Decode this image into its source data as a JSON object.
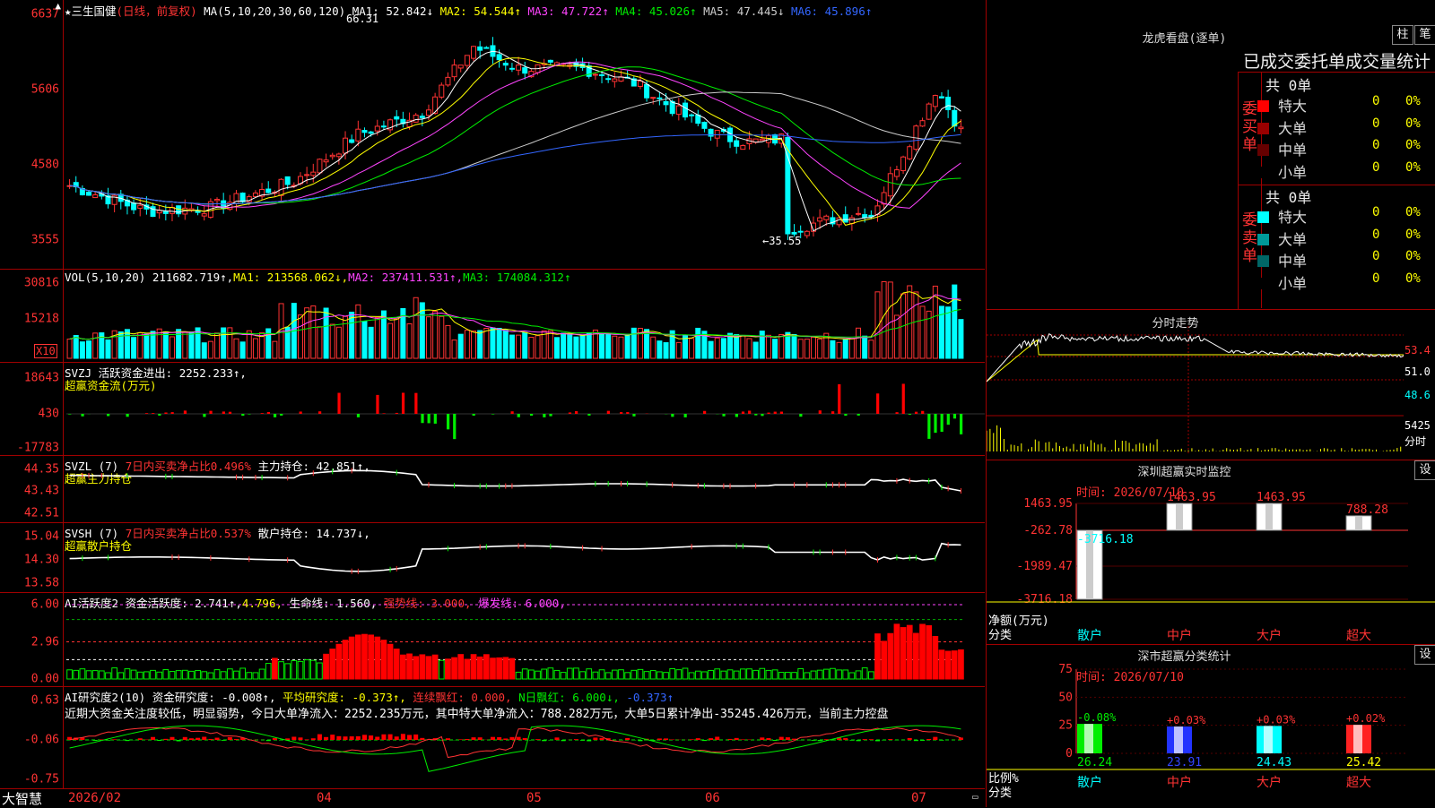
{
  "main": {
    "stock": "三生国健",
    "mode": "(日线，前复权)",
    "ma_params": "MA(5,10,20,30,60,120)",
    "ma": [
      {
        "label": "MA1:",
        "value": "52.842",
        "arrow": "↓",
        "color": "#ffffff"
      },
      {
        "label": "MA2:",
        "value": "54.544",
        "arrow": "↑",
        "color": "#ffff00"
      },
      {
        "label": "MA3:",
        "value": "47.722",
        "arrow": "↑",
        "color": "#ff44ff"
      },
      {
        "label": "MA4:",
        "value": "45.026",
        "arrow": "↑",
        "color": "#00ee00"
      },
      {
        "label": "MA5:",
        "value": "47.445",
        "arrow": "↓",
        "color": "#cccccc"
      },
      {
        "label": "MA6:",
        "value": "45.896",
        "arrow": "↑",
        "color": "#3366ff"
      }
    ],
    "yticks": [
      "6637",
      "5606",
      "4580",
      "3555"
    ],
    "high_label": "66.31",
    "low_label": "←35.55"
  },
  "vol": {
    "params": "VOL(5,10,20)",
    "value": "211682.719↑,",
    "ma": [
      {
        "label": "MA1:",
        "value": "213568.062↓,",
        "color": "#ffff00"
      },
      {
        "label": "MA2:",
        "value": "237411.531↑,",
        "color": "#ff44ff"
      },
      {
        "label": "MA3:",
        "value": "174084.312↑",
        "color": "#00ee00"
      }
    ],
    "yticks": [
      "30816",
      "15218"
    ],
    "x10": "X10"
  },
  "svzj": {
    "name": "SVZJ",
    "desc": "活跃资金进出:",
    "value": "2252.233↑,",
    "sub": "超赢资金流(万元)",
    "yticks": [
      "18643",
      "430",
      "-17783"
    ]
  },
  "svzl": {
    "name": "SVZL (7)",
    "desc": "7日内买卖净占比0.496%",
    "desc2": "主力持仓:",
    "value": "42.851↑,",
    "sub": "超赢主力持仓",
    "yticks": [
      "44.35",
      "43.43",
      "42.51"
    ]
  },
  "svsh": {
    "name": "SVSH (7)",
    "desc": "7日内买卖净占比0.537%",
    "desc2": "散户持仓:",
    "value": "14.737↓,",
    "sub": "超赢散户持仓",
    "yticks": [
      "15.04",
      "14.30",
      "13.58"
    ]
  },
  "ai2": {
    "name": "AI活跃度2",
    "l1": "资金活跃度:",
    "v1": "2.741↑,",
    "v2": "4.796,",
    "l3": "生命线:",
    "v3": "1.560,",
    "l4": "强势线:",
    "v4": "3.000,",
    "l5": "爆发线:",
    "v5": "6.000,",
    "yticks": [
      "6.00",
      "2.96",
      "0.00"
    ]
  },
  "ai_research": {
    "name": "AI研究度2(10)",
    "l1": "资金研究度:",
    "v1": "-0.008↑,",
    "l2": "平均研究度:",
    "v2": "-0.373↑,",
    "l3": "连续飘红:",
    "v3": "0.000,",
    "l4": "N日飘红:",
    "v4": "6.000↓,",
    "v5": "-0.373↑",
    "comment": "近期大资金关注度较低，明显弱势，今日大单净流入：2252.235万元，其中特大单净流入：788.282万元，大单5日累计净出-35245.426万元，当前主力控盘",
    "yticks": [
      "0.63",
      "-0.06",
      "-0.75"
    ]
  },
  "xaxis": {
    "labels": [
      "2026/02",
      "04",
      "05",
      "06",
      "07"
    ],
    "brand": "大智慧"
  },
  "lhb": {
    "title": "龙虎看盘(逐单)",
    "btn1": "柱",
    "btn2": "笔",
    "header": "已成交委托单成交量统计",
    "buy_side": "委买单",
    "sell_side": "委卖单",
    "buy_total": "共 0单",
    "sell_total": "共 0单",
    "buy_rows": [
      {
        "label": "特大",
        "n": "0",
        "p": "0%",
        "color": "#ff0000"
      },
      {
        "label": "大单",
        "n": "0",
        "p": "0%",
        "color": "#990000"
      },
      {
        "label": "中单",
        "n": "0",
        "p": "0%",
        "color": "#660000"
      },
      {
        "label": "小单",
        "n": "0",
        "p": "0%",
        "color": "#000000"
      }
    ],
    "sell_rows": [
      {
        "label": "特大",
        "n": "0",
        "p": "0%",
        "color": "#00ffff"
      },
      {
        "label": "大单",
        "n": "0",
        "p": "0%",
        "color": "#009999"
      },
      {
        "label": "中单",
        "n": "0",
        "p": "0%",
        "color": "#006666"
      },
      {
        "label": "小单",
        "n": "0",
        "p": "0%",
        "color": "#000000"
      }
    ]
  },
  "intraday": {
    "title": "分时走势",
    "yticks": [
      "53.4",
      "51.0",
      "48.6"
    ],
    "vol_label": "5425",
    "vol_unit": "分时"
  },
  "sz_monitor": {
    "title": "深圳超赢实时监控",
    "btn": "设",
    "time": "时间: 2026/07/10",
    "yticks": [
      "1463.95",
      "-262.78",
      "-1989.47",
      "-3716.18"
    ],
    "ylabel": "净额(万元)",
    "xlabel": "分类",
    "cats": [
      "散户",
      "中户",
      "大户",
      "超大"
    ],
    "values": [
      "-3716.18",
      "1463.95",
      "1463.95",
      "788.28"
    ]
  },
  "sz_class": {
    "title": "深市超赢分类统计",
    "btn": "设",
    "time": "时间: 2026/07/10",
    "yticks": [
      "75",
      "50",
      "25",
      "0"
    ],
    "ylabel": "比例%",
    "xlabel": "分类",
    "cats": [
      "散户",
      "中户",
      "大户",
      "超大"
    ],
    "top": [
      "-0.08%",
      "+0.03%",
      "+0.03%",
      "+0.02%"
    ],
    "bottom": [
      "26.24",
      "23.91",
      "24.43",
      "25.42"
    ]
  }
}
